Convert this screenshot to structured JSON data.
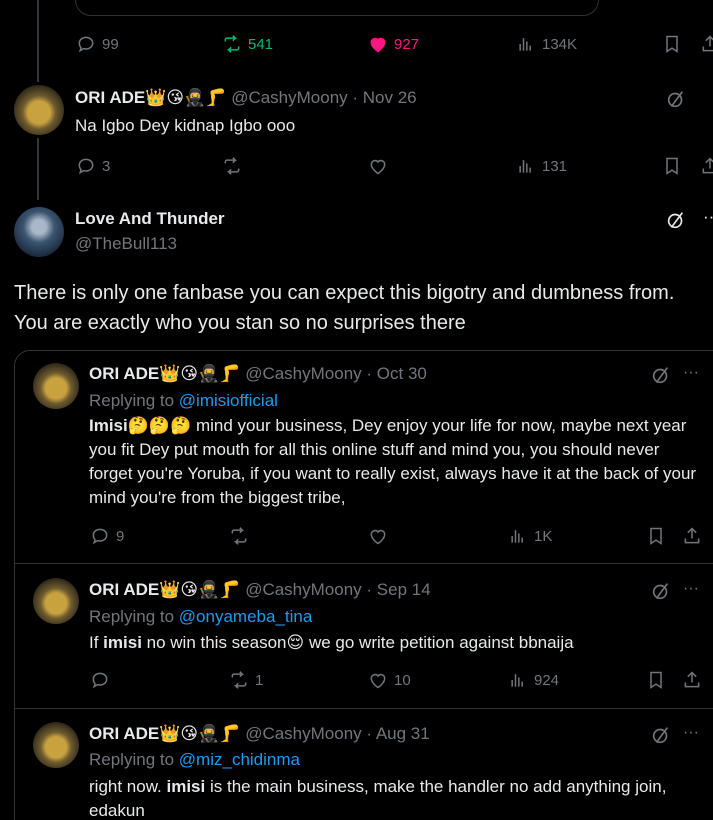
{
  "top_post": {
    "replies": "99",
    "reposts": "541",
    "likes": "927",
    "views": "134K",
    "repost_color": "#00ba7c",
    "like_color": "#f91880"
  },
  "reply1": {
    "name": "ORI ADE",
    "emojis": "👑😘🥷🦵",
    "handle": "@CashyMoony",
    "date": "· Nov 26",
    "text": "Na Igbo Dey kidnap Igbo ooo",
    "replies": "3",
    "views": "131"
  },
  "main_post": {
    "name": "Love And Thunder",
    "handle": "@TheBull113",
    "text": "There is only one fanbase you can expect this bigotry and dumbness from. You are exactly who you stan so no surprises there"
  },
  "quotes": [
    {
      "name": "ORI ADE",
      "emojis": "👑😘🥷🦵",
      "handle": "@CashyMoony",
      "date": "· Oct 30",
      "replying_prefix": "Replying to",
      "replying_to": "@imisiofficial",
      "text_bold": "Imisi",
      "text_emojis": "🤔🤔🤔",
      "text": " mind your business, Dey enjoy your life for now, maybe next year you fit Dey put mouth for all this online stuff and mind you, you should never forget you're Yoruba, if you want to really exist, always have it at the back of your mind you're from the biggest tribe,",
      "replies": "9",
      "reposts": "",
      "likes": "",
      "views": "1K"
    },
    {
      "name": "ORI ADE",
      "emojis": "👑😘🥷🦵",
      "handle": "@CashyMoony",
      "date": "· Sep 14",
      "replying_prefix": "Replying to",
      "replying_to": "@onyameba_tina",
      "text_pre": "If ",
      "text_bold": "imisi",
      "text": " no win this season😌 we go write petition against bbnaija",
      "replies": "",
      "reposts": "1",
      "likes": "10",
      "views": "924"
    },
    {
      "name": "ORI ADE",
      "emojis": "👑😘🥷🦵",
      "handle": "@CashyMoony",
      "date": "· Aug 31",
      "replying_prefix": "Replying to",
      "replying_to": "@miz_chidinma",
      "text_pre": "right now. ",
      "text_bold": "imisi",
      "text": " is the main business, make the handler no add anything join, edakun"
    }
  ],
  "more_label": "···"
}
